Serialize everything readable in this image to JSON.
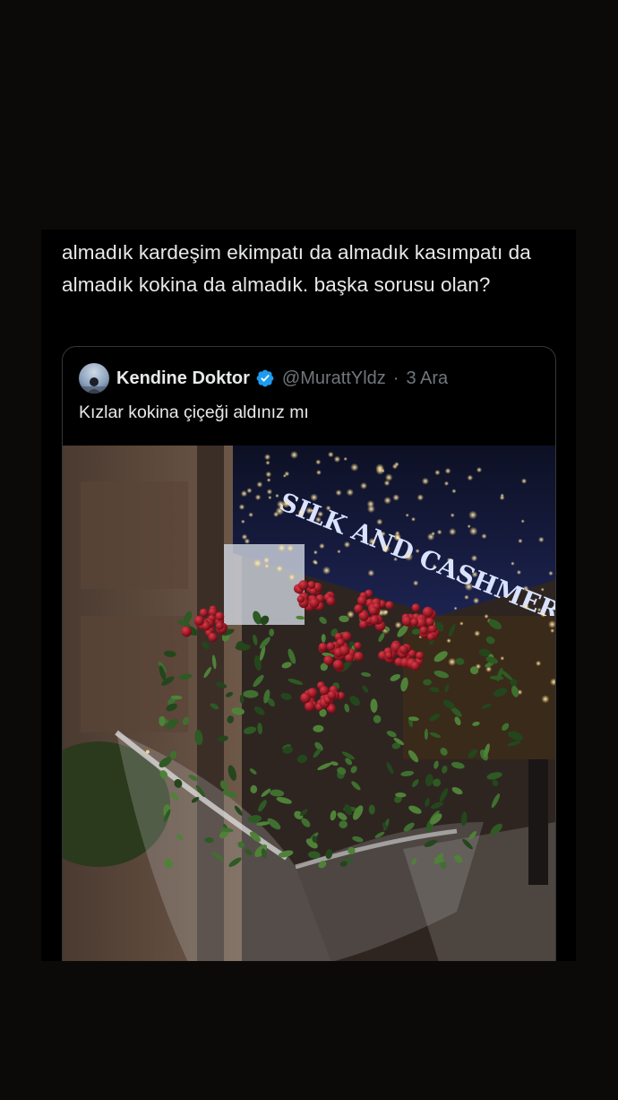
{
  "tweet": {
    "text": "almadık kardeşim ekimpatı da almadık kasımpatı da almadık kokina da almadık. başka sorusu olan?"
  },
  "quoted_tweet": {
    "display_name": "Kendine Doktor",
    "verified": true,
    "verified_icon": "verified-badge-icon",
    "handle": "@MurattYldz",
    "separator": "·",
    "date": "3 Ara",
    "text": "Kızlar kokina çiçeği aldınız mı",
    "photo_sign_text": "SILK AND CASHMERE"
  },
  "colors": {
    "background": "#0b0a09",
    "card": "#000000",
    "text": "#e7e9ea",
    "secondary": "#71767b",
    "border": "#333639",
    "verified": "#1d9bf0"
  }
}
